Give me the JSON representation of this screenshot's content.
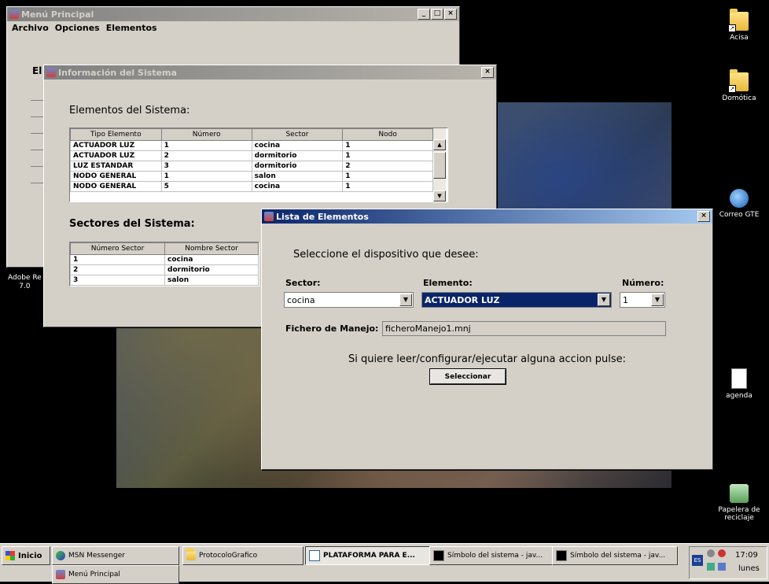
{
  "desktop": {
    "icons": [
      {
        "label": "Acisa",
        "icon": "folder-icon"
      },
      {
        "label": "Domótica",
        "icon": "folder-icon"
      },
      {
        "label": "Correo GTE",
        "icon": "globe-icon"
      },
      {
        "label": "agenda",
        "icon": "document-icon"
      },
      {
        "label": "Papelera de reciclaje",
        "icon": "recycle-bin-icon"
      }
    ],
    "partial_icon_label_1": "Adobe Re",
    "partial_icon_label_2": "7.0"
  },
  "main_window": {
    "title": "Menú Principal",
    "menu": [
      "Archivo",
      "Opciones",
      "Elementos"
    ],
    "partial_label": "El",
    "buttons": {
      "minimize": "_",
      "maximize": "□",
      "close": "×"
    }
  },
  "info_window": {
    "title": "Información del Sistema",
    "close": "×",
    "elements_heading": "Elementos del Sistema:",
    "elements_table": {
      "columns": [
        "Tipo Elemento",
        "Número",
        "Sector",
        "Nodo"
      ],
      "rows": [
        [
          "ACTUADOR LUZ",
          "1",
          "cocina",
          "1"
        ],
        [
          "ACTUADOR LUZ",
          "2",
          "dormitorio",
          "1"
        ],
        [
          "LUZ ESTANDAR",
          "3",
          "dormitorio",
          "2"
        ],
        [
          "NODO GENERAL",
          "1",
          "salon",
          "1"
        ],
        [
          "NODO GENERAL",
          "5",
          "cocina",
          "1"
        ]
      ]
    },
    "sectors_heading": "Sectores del Sistema:",
    "sectors_table": {
      "columns": [
        "Número Sector",
        "Nombre Sector"
      ],
      "rows": [
        [
          "1",
          "cocina"
        ],
        [
          "2",
          "dormitorio"
        ],
        [
          "3",
          "salon"
        ]
      ]
    }
  },
  "list_window": {
    "title": "Lista de Elementos",
    "close": "×",
    "prompt": "Seleccione el dispositivo que desee:",
    "sector_label": "Sector:",
    "sector_value": "cocina",
    "element_label": "Elemento:",
    "element_value": "ACTUADOR LUZ",
    "number_label": "Número:",
    "number_value": "1",
    "file_label": "Fichero de Manejo:",
    "file_value": "ficheroManejo1.mnj",
    "action_text": "Si quiere leer/configurar/ejecutar alguna accion pulse:",
    "select_button": "Seleccionar"
  },
  "taskbar": {
    "start": "Inicio",
    "tasks": [
      {
        "label": "MSN Messenger",
        "icon": "messenger-icon"
      },
      {
        "label": "ProtocoloGrafico",
        "icon": "folder-icon"
      },
      {
        "label": "PLATAFORMA PARA E...",
        "icon": "document-icon",
        "active": true
      },
      {
        "label": "Símbolo del sistema - jav...",
        "icon": "console-icon"
      },
      {
        "label": "Símbolo del sistema - jav...",
        "icon": "console-icon"
      }
    ],
    "second_row_task": "Menú Principal",
    "language": "ES",
    "clock": "17:09",
    "day": "lunes"
  }
}
